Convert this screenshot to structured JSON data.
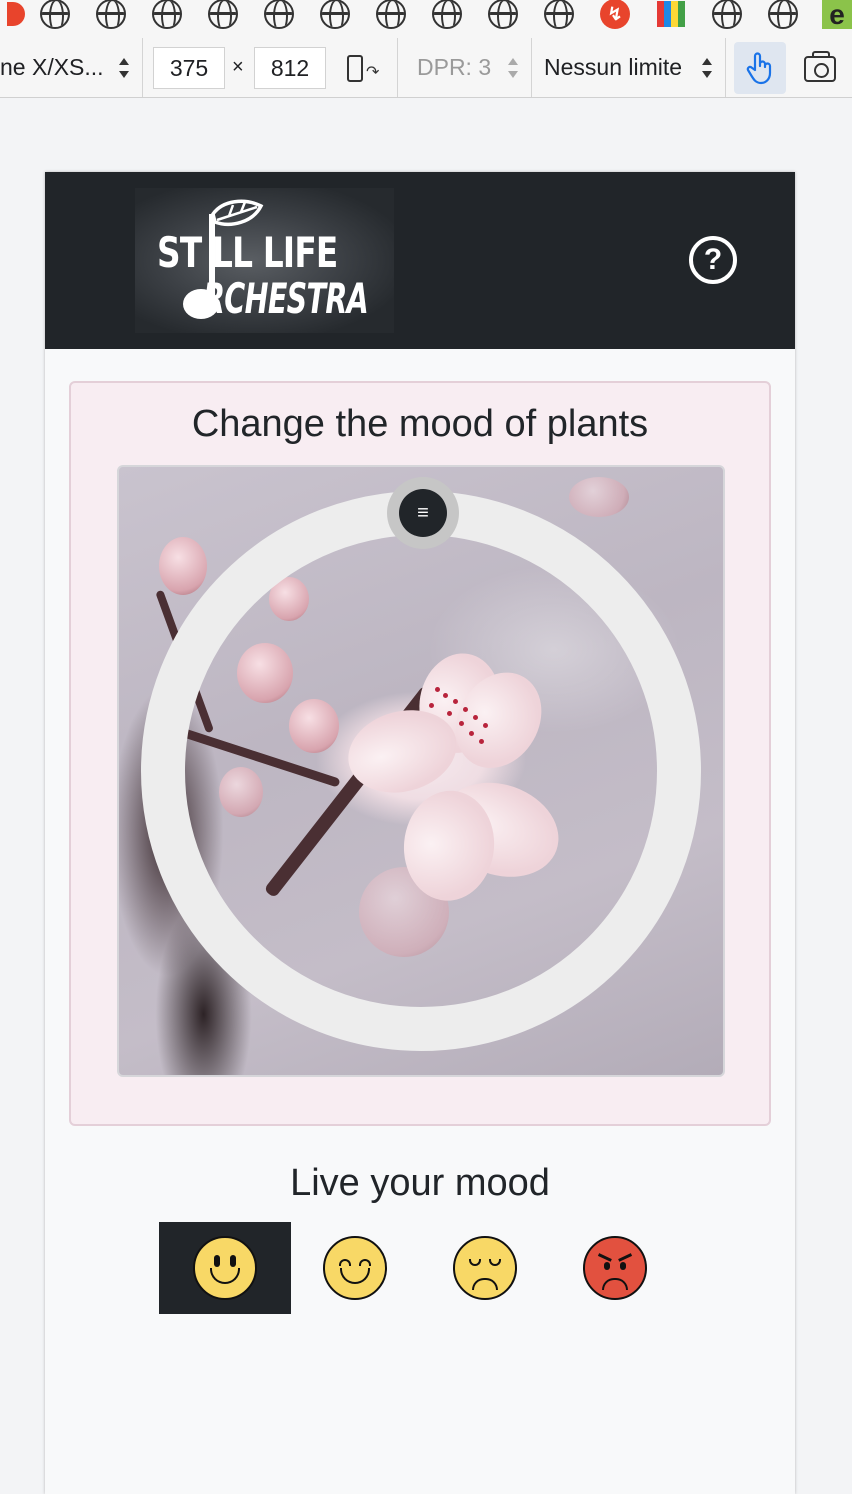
{
  "browser": {
    "bookmarks": [
      "cloud-icon",
      "globe-icon",
      "globe-icon",
      "globe-icon",
      "globe-icon",
      "globe-icon",
      "globe-icon",
      "globe-icon",
      "globe-icon",
      "globe-icon",
      "red-badge-icon",
      "multicolor-icon",
      "globe-icon",
      "globe-icon",
      "e-icon"
    ],
    "device_toolbar": {
      "device_label": "ne X/XS...",
      "width": "375",
      "times": "×",
      "height": "812",
      "dpr_label": "DPR: 3",
      "throttle_label": "Nessun limite"
    }
  },
  "app": {
    "logo": {
      "line1": "ST LL LIFE",
      "line2": "RCHESTRA"
    },
    "help_label": "?",
    "card_title": "Change the mood of plants",
    "knob_icon": "≡",
    "mood_title": "Live your mood",
    "moods": [
      {
        "name": "happy",
        "active": true
      },
      {
        "name": "smiling",
        "active": false
      },
      {
        "name": "sad",
        "active": false
      },
      {
        "name": "angry",
        "active": false
      }
    ]
  },
  "colors": {
    "navbar": "#212529",
    "card_bg": "#f8edf2",
    "ring": "#ededed",
    "face_yellow": "#f8d866",
    "face_red": "#e2513f"
  }
}
